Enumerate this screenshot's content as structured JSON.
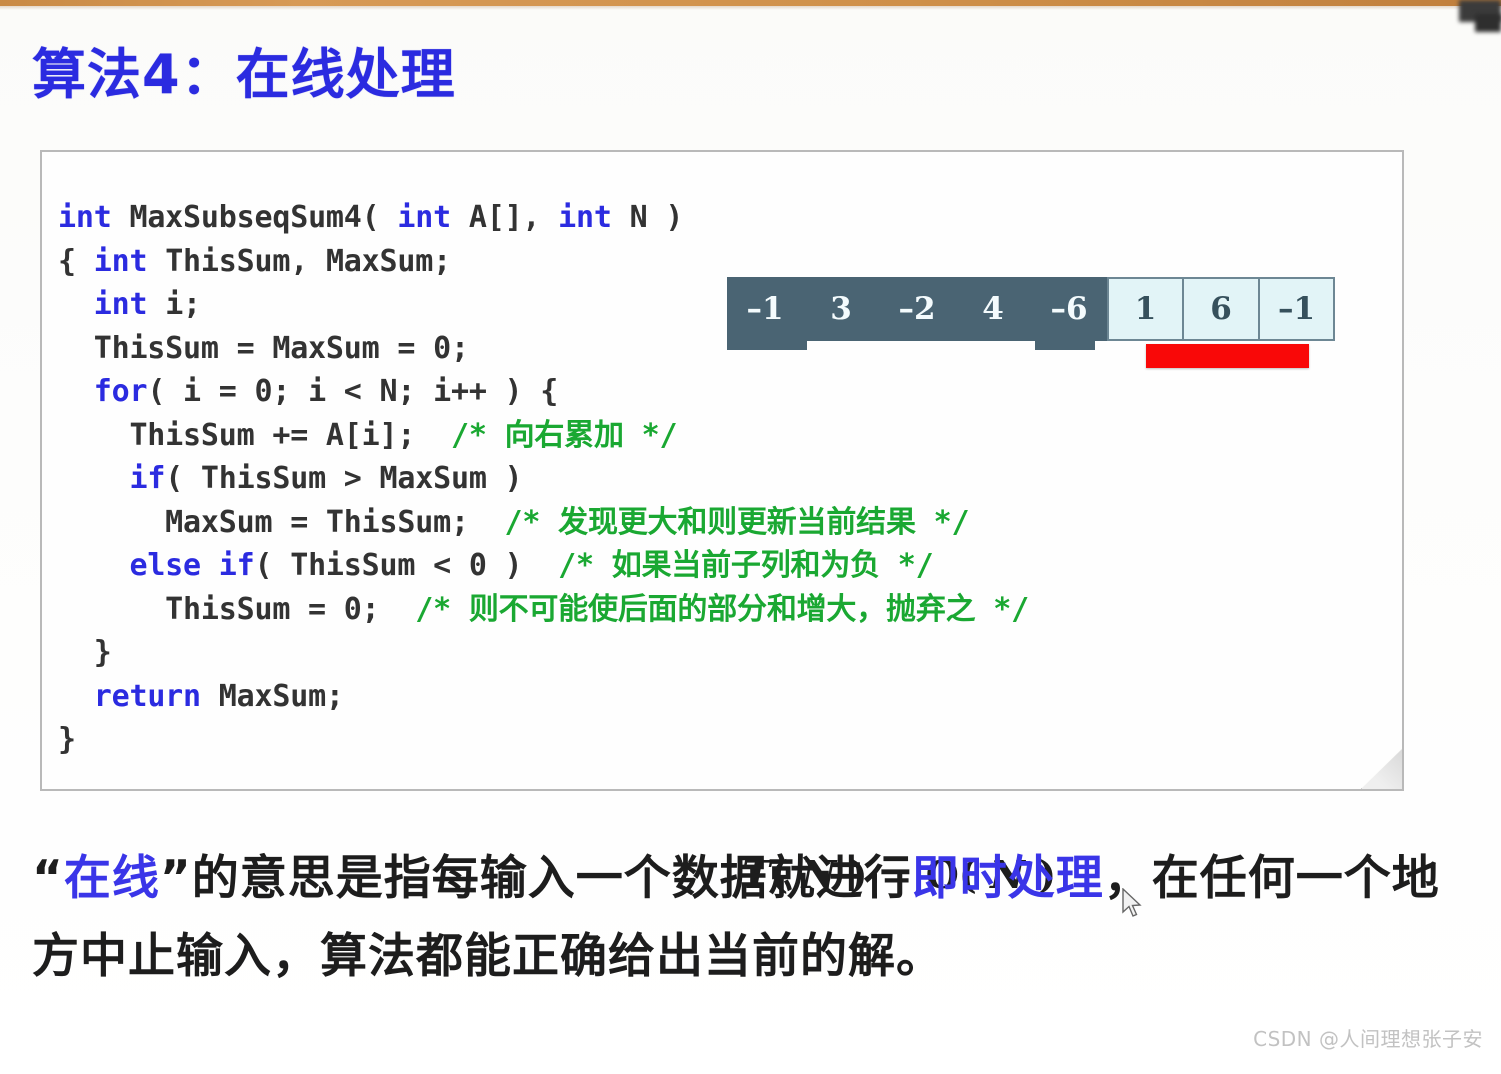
{
  "slide": {
    "title": "算法4：在线处理",
    "title_color": "#2b2be0"
  },
  "code": {
    "lines": [
      [
        {
          "t": "int",
          "c": "kw"
        },
        {
          "t": " MaxSubseqSum4( ",
          "c": "id"
        },
        {
          "t": "int",
          "c": "kw"
        },
        {
          "t": " A[], ",
          "c": "id"
        },
        {
          "t": "int",
          "c": "kw"
        },
        {
          "t": " N )",
          "c": "id"
        }
      ],
      [
        {
          "t": "{ ",
          "c": "id"
        },
        {
          "t": "int",
          "c": "kw"
        },
        {
          "t": " ThisSum, MaxSum;",
          "c": "id"
        }
      ],
      [
        {
          "t": "  ",
          "c": "id"
        },
        {
          "t": "int",
          "c": "kw"
        },
        {
          "t": " i;",
          "c": "id"
        }
      ],
      [
        {
          "t": "  ThisSum = MaxSum = 0;",
          "c": "id"
        }
      ],
      [
        {
          "t": "  ",
          "c": "id"
        },
        {
          "t": "for",
          "c": "kw"
        },
        {
          "t": "( i = 0; i < N; i++ ) {",
          "c": "id"
        }
      ],
      [
        {
          "t": "    ThisSum += A[i];  ",
          "c": "id"
        },
        {
          "t": "/* ",
          "c": "cm"
        },
        {
          "t": "向右累加",
          "c": "cmz"
        },
        {
          "t": " */",
          "c": "cm"
        }
      ],
      [
        {
          "t": "    ",
          "c": "id"
        },
        {
          "t": "if",
          "c": "kw"
        },
        {
          "t": "( ThisSum > MaxSum )",
          "c": "id"
        }
      ],
      [
        {
          "t": "      MaxSum = ThisSum;  ",
          "c": "id"
        },
        {
          "t": "/* ",
          "c": "cm"
        },
        {
          "t": "发现更大和则更新当前结果",
          "c": "cmz"
        },
        {
          "t": " */",
          "c": "cm"
        }
      ],
      [
        {
          "t": "    ",
          "c": "id"
        },
        {
          "t": "else if",
          "c": "kw"
        },
        {
          "t": "( ThisSum < 0 )  ",
          "c": "id"
        },
        {
          "t": "/* ",
          "c": "cm"
        },
        {
          "t": "如果当前子列和为负",
          "c": "cmz"
        },
        {
          "t": " */",
          "c": "cm"
        }
      ],
      [
        {
          "t": "      ThisSum = 0;  ",
          "c": "id"
        },
        {
          "t": "/* ",
          "c": "cm"
        },
        {
          "t": "则不可能使后面的部分和增大，抛弃之",
          "c": "cmz"
        },
        {
          "t": " */",
          "c": "cm"
        }
      ],
      [
        {
          "t": "  }",
          "c": "id"
        }
      ],
      [
        {
          "t": "  ",
          "c": "id"
        },
        {
          "t": "return",
          "c": "kw"
        },
        {
          "t": " MaxSum;",
          "c": "id"
        }
      ],
      [
        {
          "t": "}",
          "c": "id"
        }
      ]
    ],
    "complexity": "T( N ) = O( N )"
  },
  "array_diagram": {
    "cells": [
      {
        "value": "–1",
        "state": "processed"
      },
      {
        "value": "3",
        "state": "processed"
      },
      {
        "value": "–2",
        "state": "processed"
      },
      {
        "value": "4",
        "state": "processed"
      },
      {
        "value": "–6",
        "state": "processed"
      },
      {
        "value": "1",
        "state": "pending"
      },
      {
        "value": "6",
        "state": "pending"
      },
      {
        "value": "–1",
        "state": "pending"
      }
    ],
    "processed_color": "#4a6473",
    "pending_color": "#e2f4f7",
    "highlight_color": "#f90808"
  },
  "paragraph": {
    "parts": [
      {
        "t": "“",
        "hl": false
      },
      {
        "t": "在线",
        "hl": true
      },
      {
        "t": "”的意思是指每输入一个数据就进行",
        "hl": false
      },
      {
        "t": "即时处理",
        "hl": true
      },
      {
        "t": "，在任何一个地方中止输入，算法都能正确给出当前的解。",
        "hl": false
      }
    ]
  },
  "watermark": {
    "text": "CSDN @人间理想张子安"
  }
}
